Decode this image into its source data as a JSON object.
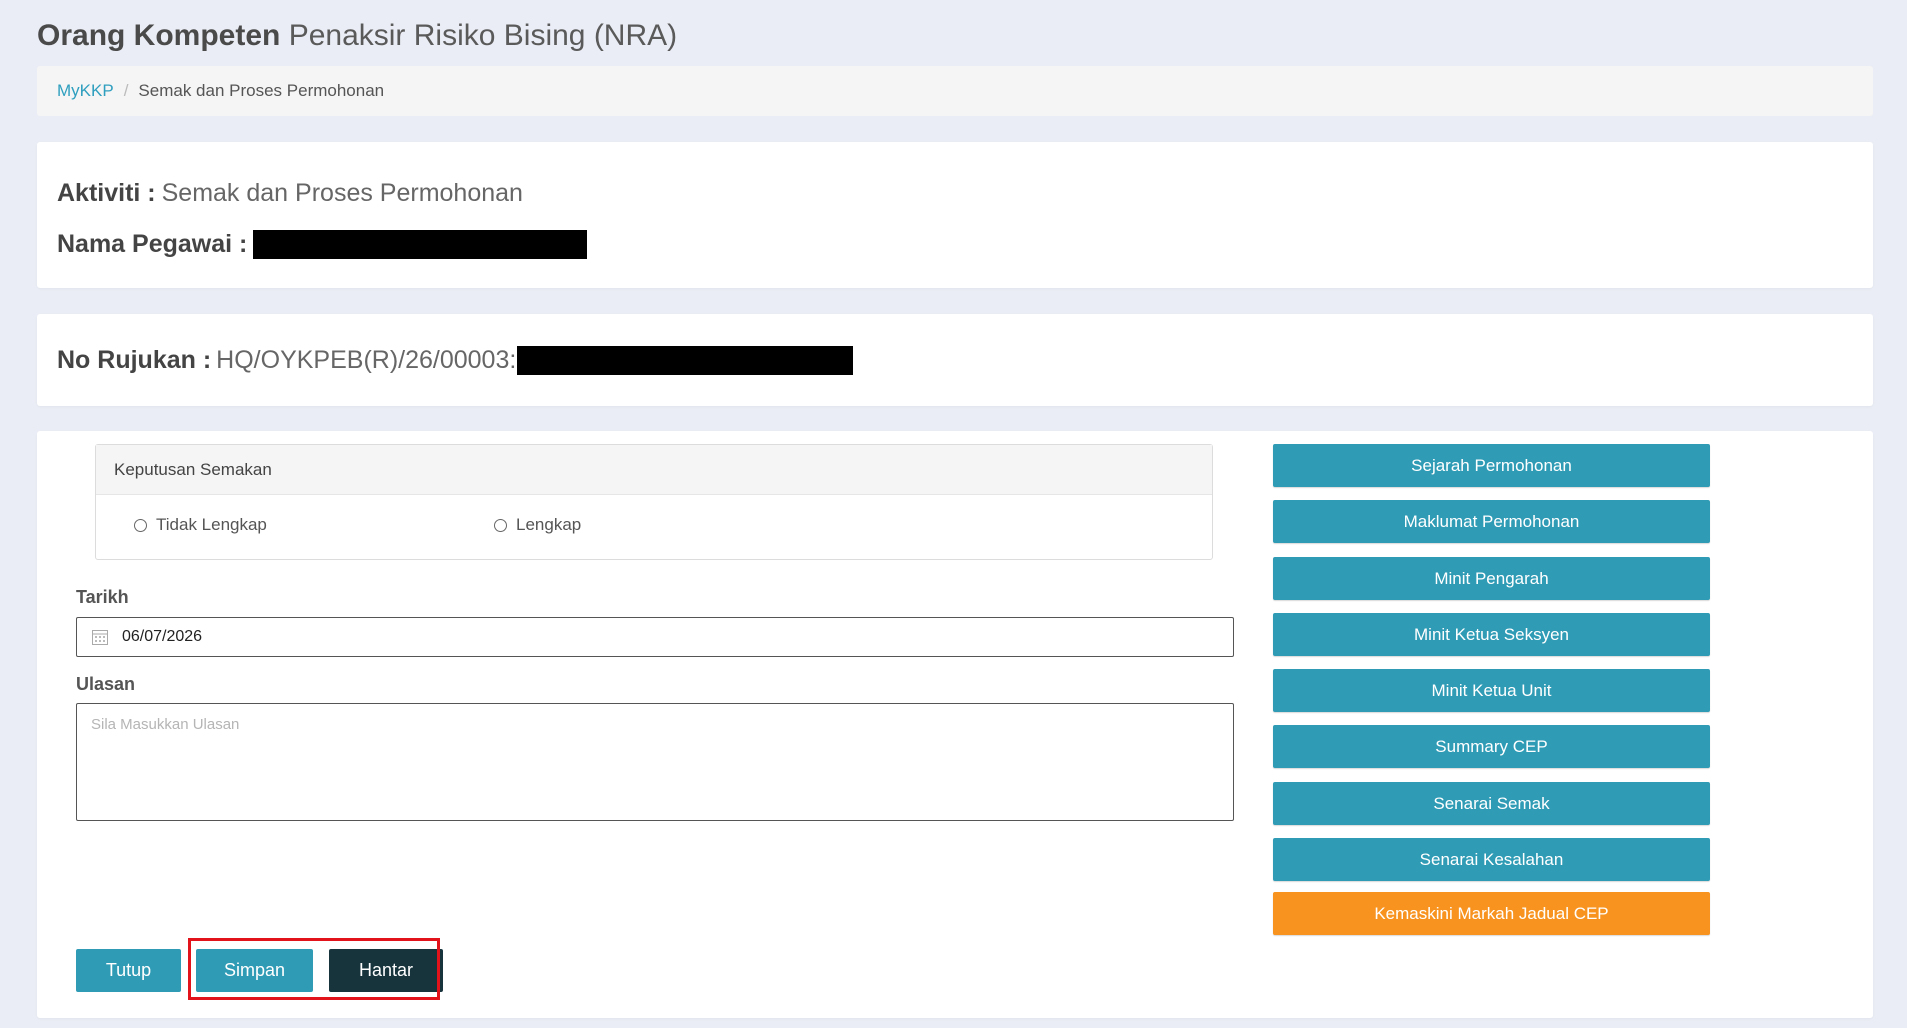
{
  "page": {
    "title_strong": "Orang Kompeten",
    "title_light": "Penaksir Risiko Bising (NRA)"
  },
  "breadcrumb": {
    "home": "MyKKP",
    "separator": "/",
    "current": "Semak dan Proses Permohonan"
  },
  "activity": {
    "label": "Aktiviti :",
    "value": "Semak dan Proses Permohonan",
    "officer_label": "Nama Pegawai :"
  },
  "reference": {
    "label": "No Rujukan :",
    "value": "HQ/OYKPEB(R)/26/00003:"
  },
  "decision": {
    "title": "Keputusan Semakan",
    "options": [
      "Tidak Lengkap",
      "Lengkap"
    ]
  },
  "form": {
    "date_label": "Tarikh",
    "date_value": "06/07/2026",
    "remark_label": "Ulasan",
    "remark_placeholder": "Sila Masukkan Ulasan"
  },
  "side_buttons": [
    "Sejarah Permohonan",
    "Maklumat Permohonan",
    "Minit Pengarah",
    "Minit Ketua Seksyen",
    "Minit Ketua Unit",
    "Summary CEP",
    "Senarai Semak",
    "Senarai Kesalahan",
    "Kemaskini Markah Jadual CEP"
  ],
  "actions": {
    "close": "Tutup",
    "save": "Simpan",
    "submit": "Hantar"
  },
  "colors": {
    "teal": "#2f9bb5",
    "orange": "#f7931e",
    "dark": "#17343d",
    "highlight": "#e2131a",
    "link": "#2f9fbf"
  }
}
